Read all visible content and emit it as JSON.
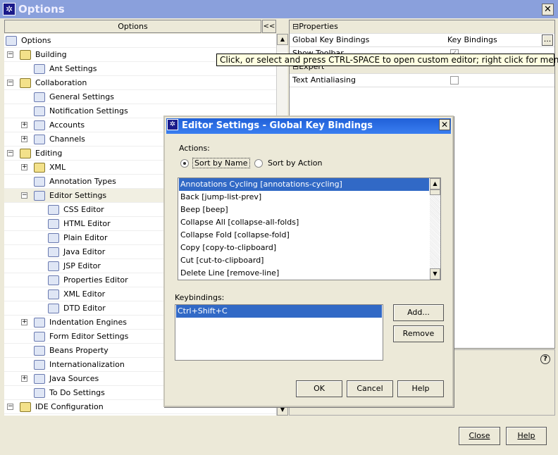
{
  "window": {
    "title": "Options",
    "close": "✕"
  },
  "tree": {
    "header": "Options",
    "collapse_label": "<<",
    "items": [
      {
        "label": "Options",
        "level": 0,
        "icon": "options-icon"
      },
      {
        "label": "Building",
        "level": 1,
        "icon": "folder-icon",
        "expander": "−"
      },
      {
        "label": "Ant Settings",
        "level": 2,
        "icon": "ant-icon"
      },
      {
        "label": "Collaboration",
        "level": 1,
        "icon": "folder-icon",
        "expander": "−"
      },
      {
        "label": "General Settings",
        "level": 2,
        "icon": "collab-settings-icon"
      },
      {
        "label": "Notification Settings",
        "level": 2,
        "icon": "notification-icon"
      },
      {
        "label": "Accounts",
        "level": 2,
        "icon": "accounts-icon",
        "expander": "+"
      },
      {
        "label": "Channels",
        "level": 2,
        "icon": "channels-icon",
        "expander": "+"
      },
      {
        "label": "Editing",
        "level": 1,
        "icon": "folder-icon",
        "expander": "−"
      },
      {
        "label": "XML",
        "level": 2,
        "icon": "folder-icon",
        "expander": "+"
      },
      {
        "label": "Annotation Types",
        "level": 2,
        "icon": "annotation-icon"
      },
      {
        "label": "Editor Settings",
        "level": 2,
        "icon": "editor-settings-icon",
        "expander": "−",
        "selected": true
      },
      {
        "label": "CSS Editor",
        "level": 3,
        "icon": "css-icon"
      },
      {
        "label": "HTML Editor",
        "level": 3,
        "icon": "editor-icon"
      },
      {
        "label": "Plain Editor",
        "level": 3,
        "icon": "editor-icon"
      },
      {
        "label": "Java Editor",
        "level": 3,
        "icon": "editor-icon"
      },
      {
        "label": "JSP Editor",
        "level": 3,
        "icon": "editor-icon"
      },
      {
        "label": "Properties Editor",
        "level": 3,
        "icon": "properties-icon"
      },
      {
        "label": "XML Editor",
        "level": 3,
        "icon": "xml-icon"
      },
      {
        "label": "DTD Editor",
        "level": 3,
        "icon": "dtd-icon"
      },
      {
        "label": "Indentation Engines",
        "level": 2,
        "icon": "indentation-icon",
        "expander": "+"
      },
      {
        "label": "Form Editor Settings",
        "level": 2,
        "icon": "form-icon"
      },
      {
        "label": "Beans Property",
        "level": 2,
        "icon": "bean-icon"
      },
      {
        "label": "Internationalization",
        "level": 2,
        "icon": "i18n-icon"
      },
      {
        "label": "Java Sources",
        "level": 2,
        "icon": "java-sources-icon",
        "expander": "+"
      },
      {
        "label": "To Do Settings",
        "level": 2,
        "icon": "todo-icon"
      },
      {
        "label": "IDE Configuration",
        "level": 1,
        "icon": "folder-icon",
        "expander": "−"
      }
    ]
  },
  "properties": {
    "cat1": "Properties",
    "cat2": "Expert",
    "rows": [
      {
        "name": "Global Key Bindings",
        "value": "Key Bindings",
        "button": "..."
      },
      {
        "name": "Show Toolbar",
        "checked": true
      },
      {
        "name": "Text Antialiasing",
        "checked": false
      }
    ]
  },
  "tooltip": "Click, or select and press CTRL-SPACE to open custom editor; right click for menu",
  "help_icon": "?",
  "bottom": {
    "close": "Close",
    "help": "Help"
  },
  "dialog": {
    "title": "Editor Settings - Global Key Bindings",
    "close": "✕",
    "actions_label": "Actions:",
    "sort_by_name": "Sort by Name",
    "sort_by_action": "Sort by Action",
    "sort_selected": "name",
    "actions": [
      "Annotations Cycling [annotations-cycling]",
      "Back [jump-list-prev]",
      "Beep [beep]",
      "Collapse All [collapse-all-folds]",
      "Collapse Fold [collapse-fold]",
      "Copy [copy-to-clipboard]",
      "Cut [cut-to-clipboard]",
      "Delete Line [remove-line]"
    ],
    "selected_action": 0,
    "keybindings_label": "Keybindings:",
    "keybindings": [
      "Ctrl+Shift+C"
    ],
    "add": "Add...",
    "remove": "Remove",
    "ok": "OK",
    "cancel": "Cancel",
    "help": "Help"
  },
  "colors": {
    "selection": "#3169c6",
    "title_active": "#2a6ae0",
    "title_inactive": "#8aa0dc",
    "tooltip": "#ffffe1"
  }
}
